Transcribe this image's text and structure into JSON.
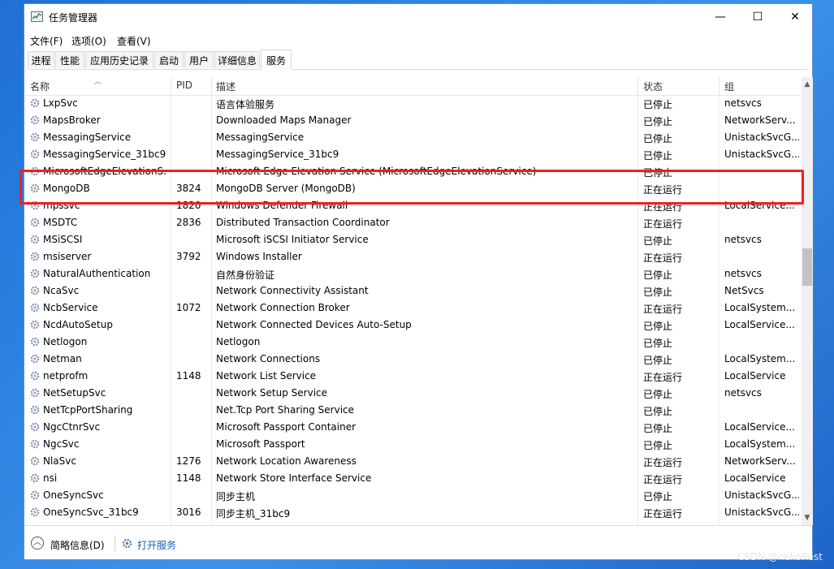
{
  "window": {
    "title": "任务管理器"
  },
  "controls": {
    "minimize": "—",
    "maximize": "☐",
    "close": "✕"
  },
  "menu": [
    "文件(F)",
    "选项(O)",
    "查看(V)"
  ],
  "tabs": [
    {
      "label": "进程",
      "active": false
    },
    {
      "label": "性能",
      "active": false
    },
    {
      "label": "应用历史记录",
      "active": false
    },
    {
      "label": "启动",
      "active": false
    },
    {
      "label": "用户",
      "active": false
    },
    {
      "label": "详细信息",
      "active": false
    },
    {
      "label": "服务",
      "active": true
    }
  ],
  "columns": {
    "name": "名称",
    "pid": "PID",
    "desc": "描述",
    "status": "状态",
    "group": "组"
  },
  "services": [
    {
      "name": "LxpSvc",
      "pid": "",
      "desc": "语言体验服务",
      "status": "已停止",
      "group": "netsvcs"
    },
    {
      "name": "MapsBroker",
      "pid": "",
      "desc": "Downloaded Maps Manager",
      "status": "已停止",
      "group": "NetworkServ..."
    },
    {
      "name": "MessagingService",
      "pid": "",
      "desc": "MessagingService",
      "status": "已停止",
      "group": "UnistackSvcG..."
    },
    {
      "name": "MessagingService_31bc9",
      "pid": "",
      "desc": "MessagingService_31bc9",
      "status": "已停止",
      "group": "UnistackSvcG..."
    },
    {
      "name": "MicrosoftEdgeElevationS...",
      "pid": "",
      "desc": "Microsoft Edge Elevation Service (MicrosoftEdgeElevationService)",
      "status": "已停止",
      "group": ""
    },
    {
      "name": "MongoDB",
      "pid": "3824",
      "desc": "MongoDB Server (MongoDB)",
      "status": "正在运行",
      "group": ""
    },
    {
      "name": "mpssvc",
      "pid": "1820",
      "desc": "Windows Defender Firewall",
      "status": "正在运行",
      "group": "LocalService..."
    },
    {
      "name": "MSDTC",
      "pid": "2836",
      "desc": "Distributed Transaction Coordinator",
      "status": "正在运行",
      "group": ""
    },
    {
      "name": "MSiSCSI",
      "pid": "",
      "desc": "Microsoft iSCSI Initiator Service",
      "status": "已停止",
      "group": "netsvcs"
    },
    {
      "name": "msiserver",
      "pid": "3792",
      "desc": "Windows Installer",
      "status": "正在运行",
      "group": ""
    },
    {
      "name": "NaturalAuthentication",
      "pid": "",
      "desc": "自然身份验证",
      "status": "已停止",
      "group": "netsvcs"
    },
    {
      "name": "NcaSvc",
      "pid": "",
      "desc": "Network Connectivity Assistant",
      "status": "已停止",
      "group": "NetSvcs"
    },
    {
      "name": "NcbService",
      "pid": "1072",
      "desc": "Network Connection Broker",
      "status": "正在运行",
      "group": "LocalSystem..."
    },
    {
      "name": "NcdAutoSetup",
      "pid": "",
      "desc": "Network Connected Devices Auto-Setup",
      "status": "已停止",
      "group": "LocalService..."
    },
    {
      "name": "Netlogon",
      "pid": "",
      "desc": "Netlogon",
      "status": "已停止",
      "group": ""
    },
    {
      "name": "Netman",
      "pid": "",
      "desc": "Network Connections",
      "status": "已停止",
      "group": "LocalSystem..."
    },
    {
      "name": "netprofm",
      "pid": "1148",
      "desc": "Network List Service",
      "status": "正在运行",
      "group": "LocalService"
    },
    {
      "name": "NetSetupSvc",
      "pid": "",
      "desc": "Network Setup Service",
      "status": "已停止",
      "group": "netsvcs"
    },
    {
      "name": "NetTcpPortSharing",
      "pid": "",
      "desc": "Net.Tcp Port Sharing Service",
      "status": "已停止",
      "group": ""
    },
    {
      "name": "NgcCtnrSvc",
      "pid": "",
      "desc": "Microsoft Passport Container",
      "status": "已停止",
      "group": "LocalService..."
    },
    {
      "name": "NgcSvc",
      "pid": "",
      "desc": "Microsoft Passport",
      "status": "已停止",
      "group": "LocalSystem..."
    },
    {
      "name": "NlaSvc",
      "pid": "1276",
      "desc": "Network Location Awareness",
      "status": "正在运行",
      "group": "NetworkServ..."
    },
    {
      "name": "nsi",
      "pid": "1148",
      "desc": "Network Store Interface Service",
      "status": "正在运行",
      "group": "LocalService"
    },
    {
      "name": "OneSyncSvc",
      "pid": "",
      "desc": "同步主机",
      "status": "已停止",
      "group": "UnistackSvcG..."
    },
    {
      "name": "OneSyncSvc_31bc9",
      "pid": "3016",
      "desc": "同步主机_31bc9",
      "status": "正在运行",
      "group": "UnistackSvcG..."
    }
  ],
  "bottom": {
    "less_details": "简略信息(D)",
    "open_services": "打开服务"
  },
  "highlight_color": "#ef2020",
  "link_color": "#1a5fb4",
  "watermark": "CSDN @nekoRest"
}
